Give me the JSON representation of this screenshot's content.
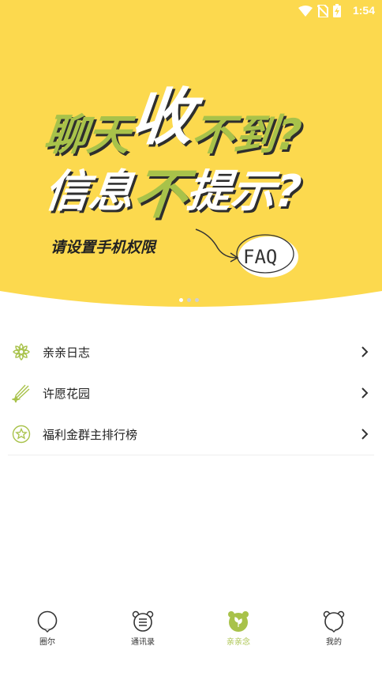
{
  "status_bar": {
    "time": "1:54"
  },
  "banner": {
    "line1_part1": "聊天",
    "line1_big": "收",
    "line1_part2": "不到?",
    "line2_part1": "信息",
    "line2_green": "不",
    "line2_part2": "提示?",
    "subtitle": "请设置手机权限",
    "badge": "FAQ",
    "slide_count": 3,
    "active_slide": 1,
    "colors": {
      "background": "#fcd94e",
      "green": "#a8c24a"
    }
  },
  "menu": {
    "items": [
      {
        "label": "亲亲日志",
        "icon": "flower-icon"
      },
      {
        "label": "许愿花园",
        "icon": "shooting-star-icon"
      },
      {
        "label": "福利金群主排行榜",
        "icon": "star-circle-icon"
      }
    ]
  },
  "tabbar": {
    "tabs": [
      {
        "label": "圈尔",
        "icon": "circle-icon",
        "active": false
      },
      {
        "label": "通讯录",
        "icon": "contacts-bear-icon",
        "active": false
      },
      {
        "label": "亲亲念",
        "icon": "bear-leaf-icon",
        "active": true
      },
      {
        "label": "我的",
        "icon": "bear-profile-icon",
        "active": false
      }
    ]
  }
}
